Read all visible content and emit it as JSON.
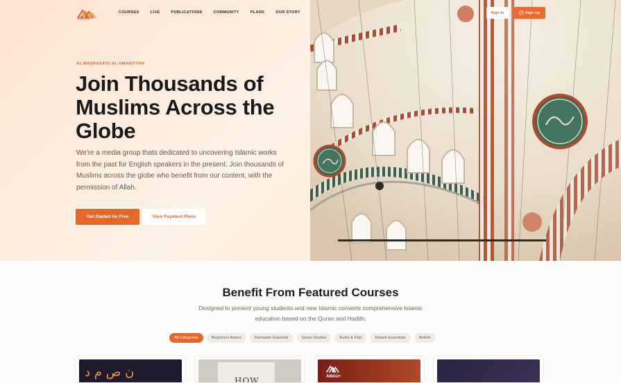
{
  "brand": {
    "name": "AMAU+",
    "accent": "#e5682b"
  },
  "nav": {
    "items": [
      "COURSES",
      "LIVE",
      "PUBLICATIONS",
      "COMMUNITY",
      "PLANS",
      "OUR STORY"
    ],
    "sign_in": "Sign In",
    "sign_up": "Sign Up"
  },
  "hero": {
    "eyebrow": "AL MADRASATU AL UMARIYYAH",
    "title": "Join Thousands of Muslims Across the Globe",
    "lead": "We're a media group thats dedicated to uncovering Islamic works from the past for English speakers in the present. Join thousands of Muslims across the globe who benefit from our content, with the permission of Allah.",
    "cta_primary": "Get Started for Free",
    "cta_secondary": "View Payment Plans"
  },
  "featured": {
    "title": "Benefit From Featured Courses",
    "subtitle": "Designed to present young students and new Islamic converts comprehensive Islamic education based on the Quran and Hadith.",
    "categories": [
      "All Categories",
      "Beginners Basics",
      "Ramadan Essential",
      "Quran Studies",
      "Rules & Fiqh",
      "Dawah Essentials",
      "Beliefs"
    ],
    "active_category": "All Categories",
    "cards": [
      {
        "thumb_text": "ن ص م د"
      },
      {
        "thumb_text": "HOW"
      },
      {
        "thumb_text": "AMAU+"
      },
      {
        "thumb_text": ""
      }
    ]
  }
}
